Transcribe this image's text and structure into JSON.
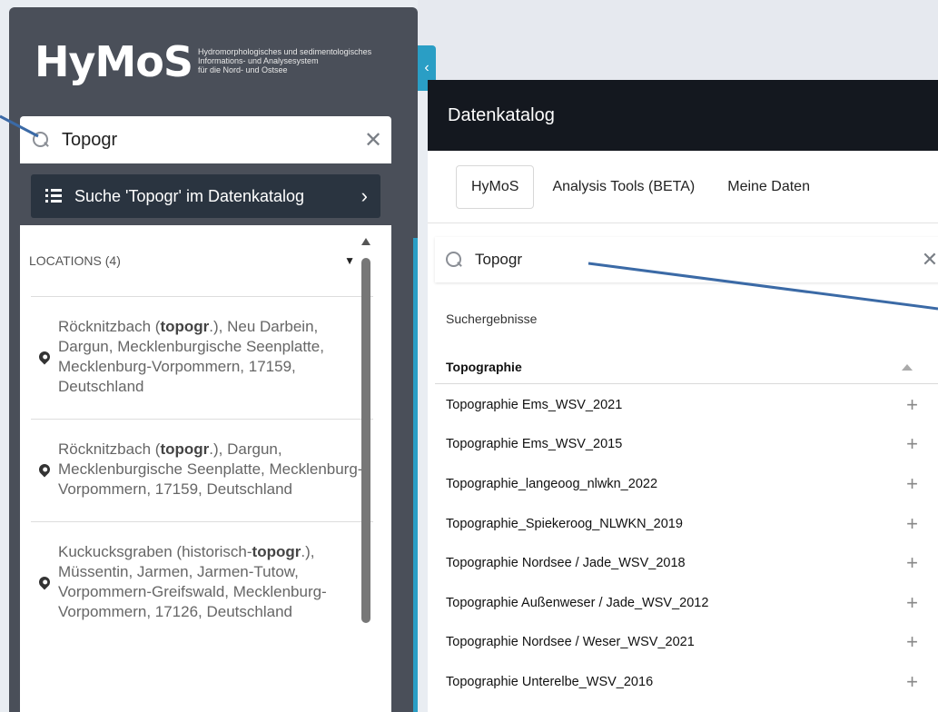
{
  "logo": {
    "word": "HyMoS",
    "sub1": "Hydromorphologisches und sedimentologisches",
    "sub2": "Informations- und Analysesystem",
    "sub3": "für die Nord- und Ostsee"
  },
  "left_search": {
    "value": "Topogr",
    "clear": "✕"
  },
  "catalog_button": {
    "label": "Suche 'Topogr' im Datenkatalog",
    "chevron": "›"
  },
  "locations": {
    "header": "LOCATIONS (4)",
    "items": [
      {
        "pre": "Röcknitzbach (",
        "bold": "topogr",
        "post": ".), Neu Darbein, Dargun, Mecklenburgische Seenplatte, Mecklenburg-Vorpommern, 17159, Deutschland"
      },
      {
        "pre": "Röcknitzbach (",
        "bold": "topogr",
        "post": ".), Dargun, Mecklenburgische Seenplatte, Mecklenburg-Vorpommern, 17159, Deutschland"
      },
      {
        "pre": "Kuckucksgraben (historisch-",
        "bold": "topogr",
        "post": ".), Müssentin, Jarmen, Jarmen-Tutow, Vorpommern-Greifswald, Mecklenburg-Vorpommern, 17126, Deutschland"
      }
    ]
  },
  "collapse": {
    "label": "‹"
  },
  "catalog": {
    "title": "Datenkatalog",
    "tabs": [
      "HyMoS",
      "Analysis Tools (BETA)",
      "Meine Daten"
    ],
    "search": {
      "value": "Topogr",
      "clear": "✕"
    },
    "section": "Suchergebnisse",
    "group": "Topographie",
    "results": [
      "Topographie Ems_WSV_2021",
      "Topographie Ems_WSV_2015",
      "Topographie_langeoog_nlwkn_2022",
      "Topographie_Spiekeroog_NLWKN_2019",
      "Topographie Nordsee / Jade_WSV_2018",
      "Topographie Außenweser / Jade_WSV_2012",
      "Topographie Nordsee / Weser_WSV_2021",
      "Topographie Unterelbe_WSV_2016"
    ],
    "add_symbol": "+"
  },
  "colors": {
    "accent": "#2a9ec5",
    "panel": "#4a4f59",
    "header": "#14181f",
    "arrow": "#3b6aa6"
  }
}
